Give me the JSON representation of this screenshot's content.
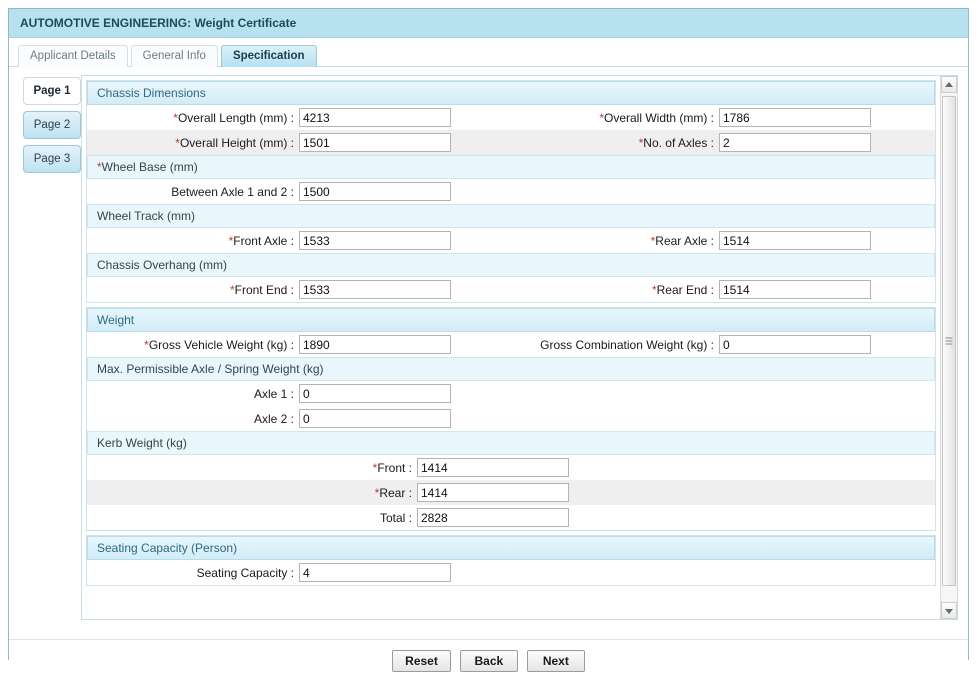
{
  "window": {
    "title": "AUTOMOTIVE ENGINEERING: Weight Certificate"
  },
  "tabs": [
    {
      "label": "Applicant Details",
      "active": false
    },
    {
      "label": "General Info",
      "active": false
    },
    {
      "label": "Specification",
      "active": true
    }
  ],
  "page_tabs": [
    {
      "label": "Page 1",
      "active": true
    },
    {
      "label": "Page 2",
      "active": false
    },
    {
      "label": "Page 3",
      "active": false
    }
  ],
  "sections": {
    "chassis": {
      "heading": "Chassis Dimensions",
      "overall_length_label": "*Overall Length (mm) :",
      "overall_length_value": "4213",
      "overall_width_label": "*Overall Width (mm) :",
      "overall_width_value": "1786",
      "overall_height_label": "*Overall Height (mm) :",
      "overall_height_value": "1501",
      "no_of_axles_label": "*No. of Axles :",
      "no_of_axles_value": "2",
      "wheel_base_heading": "*Wheel Base (mm)",
      "between_axle_label": "Between Axle 1 and 2 :",
      "between_axle_value": "1500",
      "wheel_track_heading": "Wheel Track (mm)",
      "front_axle_label": "*Front Axle :",
      "front_axle_value": "1533",
      "rear_axle_label": "*Rear Axle :",
      "rear_axle_value": "1514",
      "overhang_heading": "Chassis Overhang (mm)",
      "front_end_label": "*Front End :",
      "front_end_value": "1533",
      "rear_end_label": "*Rear End :",
      "rear_end_value": "1514"
    },
    "weight": {
      "heading": "Weight",
      "gross_vehicle_label": "*Gross Vehicle Weight (kg) :",
      "gross_vehicle_value": "1890",
      "gross_combination_label": "Gross Combination Weight (kg) :",
      "gross_combination_value": "0",
      "max_axle_heading": "Max. Permissible Axle / Spring Weight (kg)",
      "axle1_label": "Axle 1 :",
      "axle1_value": "0",
      "axle2_label": "Axle 2 :",
      "axle2_value": "0",
      "kerb_heading": "Kerb Weight (kg)",
      "kerb_front_label": "*Front :",
      "kerb_front_value": "1414",
      "kerb_rear_label": "*Rear :",
      "kerb_rear_value": "1414",
      "kerb_total_label": "Total :",
      "kerb_total_value": "2828"
    },
    "seating": {
      "heading": "Seating Capacity (Person)",
      "seating_capacity_label": "Seating Capacity :",
      "seating_capacity_value": "4"
    }
  },
  "footer": {
    "reset_label": "Reset",
    "back_label": "Back",
    "next_label": "Next"
  },
  "scrollbar": {
    "up_icon": "triangle-up-icon",
    "down_icon": "triangle-down-icon"
  },
  "colors": {
    "title_bar": "#b8e1ef",
    "section_head": "#d3ecf7",
    "required_marker": "#c0392b",
    "alt_row": "#efefef",
    "frame_border": "#8fb8c9"
  }
}
